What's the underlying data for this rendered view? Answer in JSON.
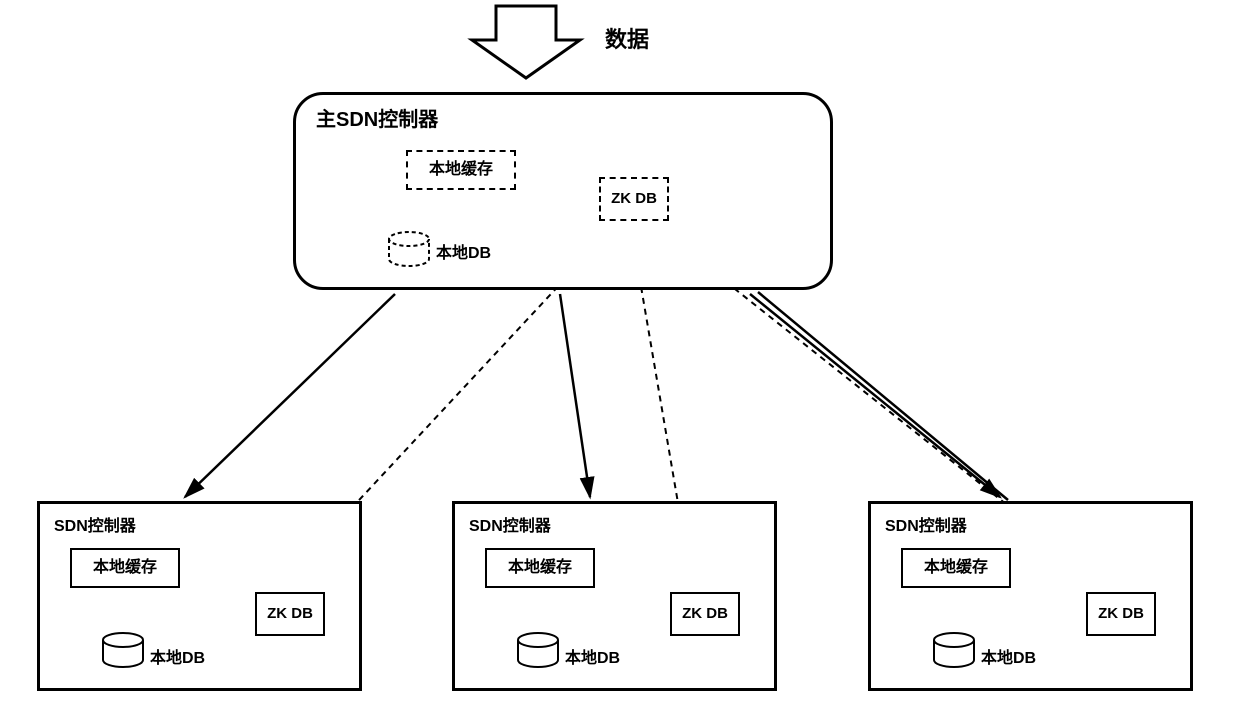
{
  "top": {
    "data_label": "数据"
  },
  "main": {
    "title": "主SDN控制器",
    "local_cache": "本地缓存",
    "local_db": "本地DB",
    "zk_db": "ZK DB"
  },
  "controllers": [
    {
      "title": "SDN控制器",
      "local_cache": "本地缓存",
      "local_db": "本地DB",
      "zk_db": "ZK DB"
    },
    {
      "title": "SDN控制器",
      "local_cache": "本地缓存",
      "local_db": "本地DB",
      "zk_db": "ZK DB"
    },
    {
      "title": "SDN控制器",
      "local_cache": "本地缓存",
      "local_db": "本地DB",
      "zk_db": "ZK DB"
    }
  ]
}
